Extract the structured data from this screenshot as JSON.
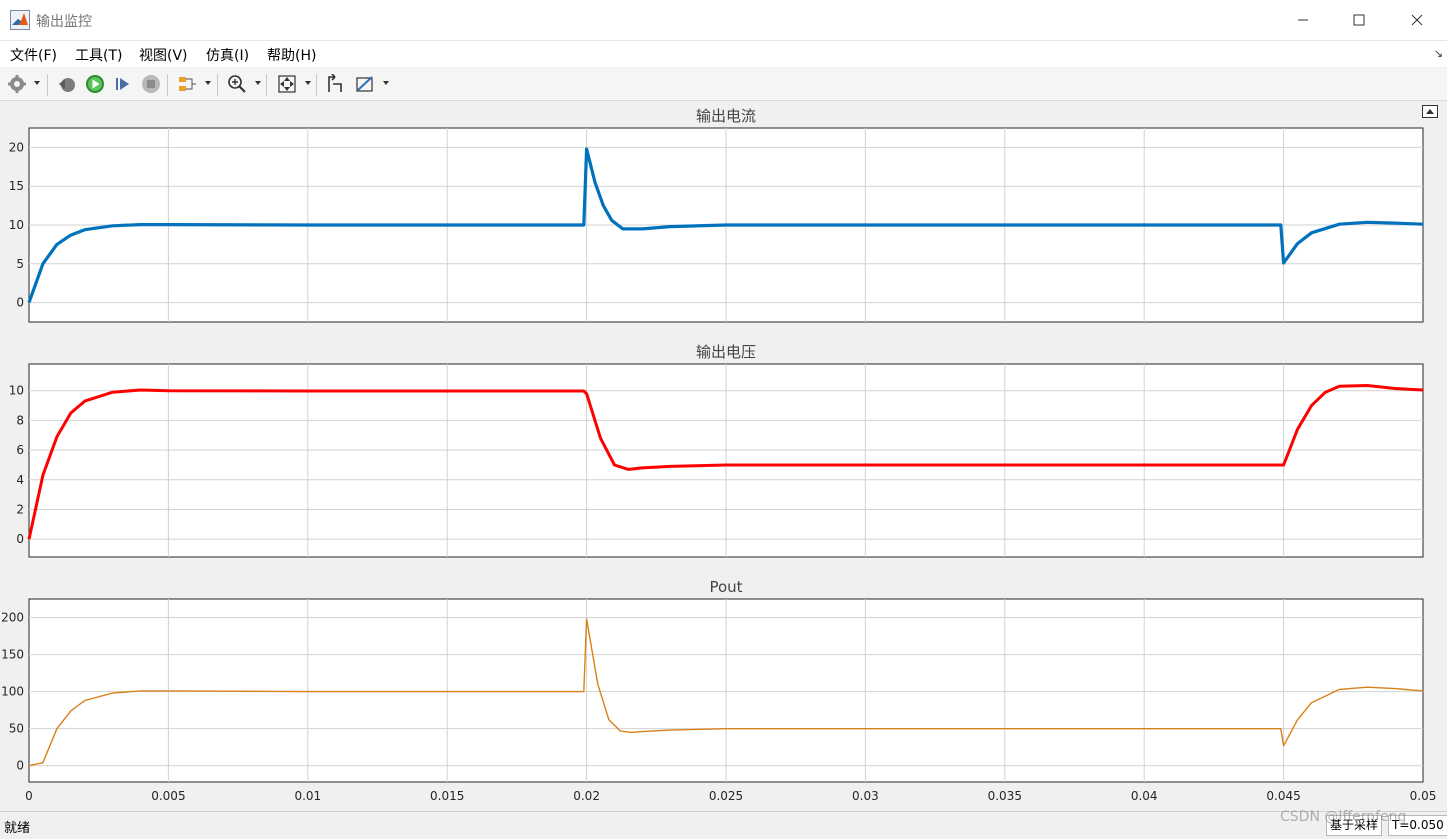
{
  "window": {
    "title": "输出监控",
    "colors": {
      "accent": "#0072bd"
    }
  },
  "menu": [
    "文件(F)",
    "工具(T)",
    "视图(V)",
    "仿真(I)",
    "帮助(H)"
  ],
  "toolbar": {
    "icons": [
      "gear-icon",
      "step-back-icon",
      "run-icon",
      "step-forward-icon",
      "stop-icon",
      "signal-select-icon",
      "zoom-in-icon",
      "autoscale-icon",
      "cursor-icon",
      "measure-icon"
    ]
  },
  "status": {
    "left": "就绪",
    "sample": "基于采样",
    "time": "T=0.050"
  },
  "watermark": "CSDN @Iffernfeng",
  "chart_data": [
    {
      "type": "line",
      "title": "输出电流",
      "color": "#0072bd",
      "xlim": [
        0,
        0.05
      ],
      "ylim": [
        -2.5,
        22.5
      ],
      "yticks": [
        0,
        5,
        10,
        15,
        20
      ],
      "x": [
        0,
        0.0005,
        0.001,
        0.0015,
        0.002,
        0.003,
        0.004,
        0.005,
        0.01,
        0.015,
        0.0199,
        0.02,
        0.0203,
        0.0206,
        0.0209,
        0.0213,
        0.022,
        0.023,
        0.025,
        0.03,
        0.035,
        0.04,
        0.0449,
        0.045,
        0.0455,
        0.046,
        0.047,
        0.048,
        0.049,
        0.05
      ],
      "y": [
        0,
        5.0,
        7.5,
        8.7,
        9.4,
        9.9,
        10.05,
        10.05,
        10.0,
        10.0,
        10.0,
        19.8,
        15.5,
        12.5,
        10.6,
        9.5,
        9.5,
        9.8,
        10.0,
        10.0,
        10.0,
        10.0,
        10.0,
        5.1,
        7.6,
        9.0,
        10.1,
        10.35,
        10.25,
        10.1
      ]
    },
    {
      "type": "line",
      "title": "输出电压",
      "color": "#ff0000",
      "xlim": [
        0,
        0.05
      ],
      "ylim": [
        -1.2,
        11.8
      ],
      "yticks": [
        0,
        2,
        4,
        6,
        8,
        10
      ],
      "x": [
        0,
        0.0005,
        0.001,
        0.0015,
        0.002,
        0.003,
        0.004,
        0.005,
        0.01,
        0.015,
        0.0199,
        0.02,
        0.0205,
        0.021,
        0.0215,
        0.022,
        0.023,
        0.025,
        0.03,
        0.035,
        0.04,
        0.0449,
        0.045,
        0.0455,
        0.046,
        0.0465,
        0.047,
        0.048,
        0.049,
        0.05
      ],
      "y": [
        0,
        4.3,
        6.9,
        8.5,
        9.3,
        9.9,
        10.05,
        10.0,
        9.98,
        9.98,
        9.98,
        9.8,
        6.8,
        5.0,
        4.7,
        4.8,
        4.9,
        5.0,
        5.0,
        5.0,
        5.0,
        5.0,
        5.0,
        7.4,
        9.0,
        9.9,
        10.3,
        10.35,
        10.15,
        10.05
      ]
    },
    {
      "type": "line",
      "title": "Pout",
      "color": "#d98019",
      "xlim": [
        0,
        0.05
      ],
      "xticks": [
        0,
        0.005,
        0.01,
        0.015,
        0.02,
        0.025,
        0.03,
        0.035,
        0.04,
        0.045,
        0.05
      ],
      "ylim": [
        -22,
        225
      ],
      "yticks": [
        0,
        50,
        100,
        150,
        200
      ],
      "x": [
        0,
        0.0005,
        0.001,
        0.0015,
        0.002,
        0.003,
        0.004,
        0.005,
        0.01,
        0.015,
        0.0199,
        0.02,
        0.0204,
        0.0208,
        0.0212,
        0.0216,
        0.022,
        0.023,
        0.025,
        0.03,
        0.035,
        0.04,
        0.0449,
        0.045,
        0.0455,
        0.046,
        0.047,
        0.048,
        0.049,
        0.05
      ],
      "y": [
        0,
        4,
        50,
        74,
        88,
        98,
        101,
        101,
        100,
        100,
        100,
        198,
        110,
        62,
        47,
        45,
        46,
        48,
        50,
        50,
        50,
        50,
        50,
        27,
        62,
        85,
        103,
        106,
        104,
        101
      ]
    }
  ]
}
